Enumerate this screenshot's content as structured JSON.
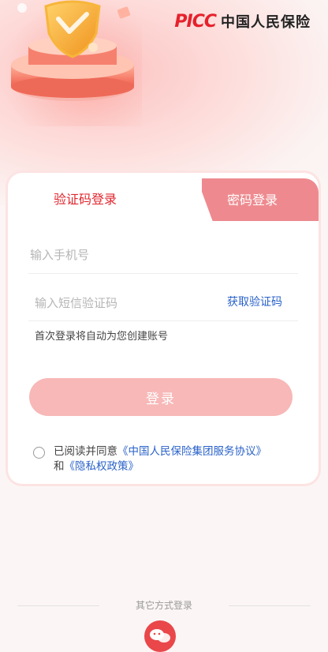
{
  "brand": {
    "logo_text": "PICC",
    "company_name": "中国人民保险"
  },
  "tabs": [
    {
      "label": "验证码登录",
      "active": true
    },
    {
      "label": "密码登录",
      "active": false
    }
  ],
  "form": {
    "phone_placeholder": "输入手机号",
    "code_placeholder": "输入短信验证码",
    "get_code_label": "获取验证码",
    "first_login_hint": "首次登录将自动为您创建账号",
    "login_button": "登录"
  },
  "agreement": {
    "prefix": "已阅读并同意",
    "service_link": "《中国人民保险集团服务协议》",
    "joiner": "和",
    "privacy_link": "《隐私权政策》",
    "checked": false
  },
  "other_login": {
    "label": "其它方式登录",
    "options": [
      {
        "icon": "wechat-icon"
      }
    ]
  },
  "colors": {
    "brand_red": "#e6212b",
    "tab_active_text": "#e0262e",
    "tab_inactive_bg": "#ee8a8f",
    "button_disabled_bg": "#f7b8b7",
    "link_blue": "#2a62c9"
  }
}
